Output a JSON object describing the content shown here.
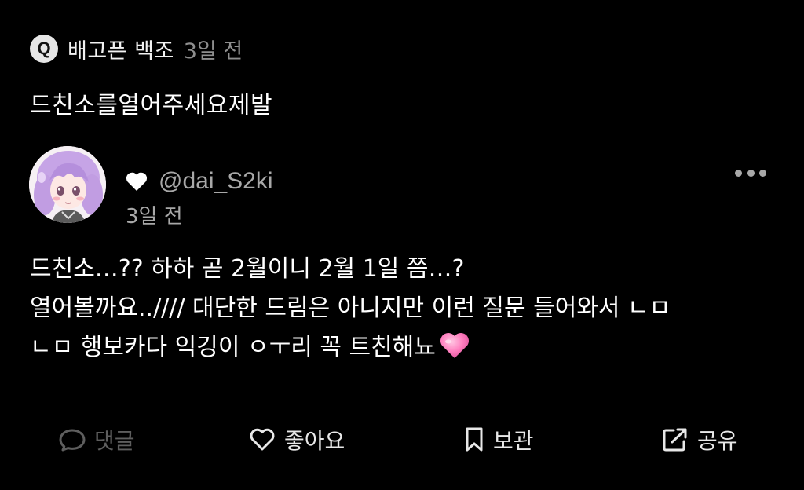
{
  "question": {
    "badge": "Q",
    "asker_name": "배고픈 백조",
    "asker_time": "3일 전",
    "text": "드친소를열어주세요제발"
  },
  "answer": {
    "handle": "@dai_S2ki",
    "time": "3일 전",
    "body_lines": [
      "드친소…?? 하하 곧 2월이니 2월 1일 쯤…?",
      "열어볼까요..//// 대단한 드림은 아니지만 이런 질문 들어와서 ㄴㅁ",
      "ㄴㅁ 행보카다 익깅이 ㅇㅜ리 꼭 트친해뇨"
    ]
  },
  "actions": {
    "comment_label": "댓글",
    "like_label": "좋아요",
    "save_label": "보관",
    "share_label": "공유"
  },
  "icons": {
    "heart_name_icon": "heart-icon",
    "more_icon": "more-dots-icon",
    "comment_icon": "speech-bubble-icon",
    "like_icon": "heart-outline-icon",
    "save_icon": "bookmark-icon",
    "share_icon": "share-arrow-icon",
    "emoji": "pink-heart-emoji"
  },
  "colors": {
    "background": "#000000",
    "primary_text": "#ffffff",
    "secondary_text": "#a8a8a8",
    "disabled_text": "#5e5e5e",
    "emoji_pink": "#ff7fbf"
  }
}
